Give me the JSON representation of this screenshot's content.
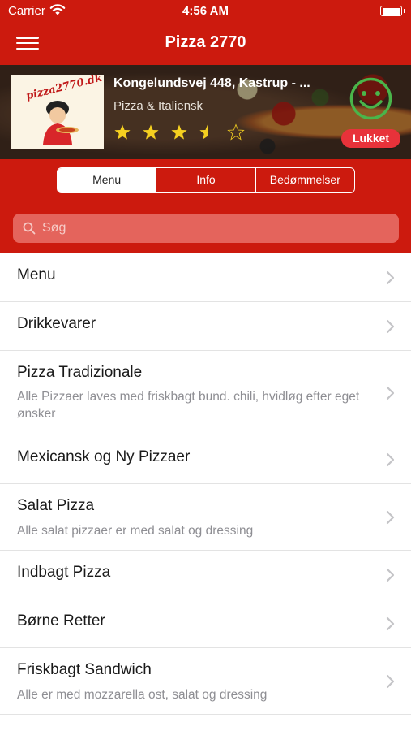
{
  "status_bar": {
    "carrier": "Carrier",
    "time": "4:56 AM"
  },
  "nav": {
    "title": "Pizza 2770",
    "menu_icon": "hamburger-menu-icon"
  },
  "restaurant": {
    "logo_text": "pizza2770.dk",
    "name": "Kongelundsvej 448, Kastrup - ...",
    "cuisine": "Pizza & Italiensk",
    "rating": 3.5,
    "rating_max": 5,
    "status": "Lukket",
    "status_color": "#e8323a",
    "smiley_icon": "happy-smiley-icon"
  },
  "tabs": [
    {
      "label": "Menu",
      "active": true
    },
    {
      "label": "Info",
      "active": false
    },
    {
      "label": "Bedømmelser",
      "active": false
    }
  ],
  "search": {
    "placeholder": "Søg",
    "value": ""
  },
  "categories": [
    {
      "title": "Menu",
      "description": ""
    },
    {
      "title": "Drikkevarer",
      "description": ""
    },
    {
      "title": "Pizza Tradizionale",
      "description": "Alle Pizzaer laves med friskbagt bund. chili, hvidløg efter eget ønsker"
    },
    {
      "title": "Mexicansk og Ny Pizzaer",
      "description": ""
    },
    {
      "title": "Salat Pizza",
      "description": "Alle salat pizzaer er med salat og dressing"
    },
    {
      "title": "Indbagt Pizza",
      "description": ""
    },
    {
      "title": "Børne Retter",
      "description": ""
    },
    {
      "title": "Friskbagt Sandwich",
      "description": "Alle er med mozzarella ost, salat og dressing"
    }
  ],
  "colors": {
    "brand": "#cc1a0e",
    "star": "#f5d020",
    "smiley": "#4ab54a"
  }
}
